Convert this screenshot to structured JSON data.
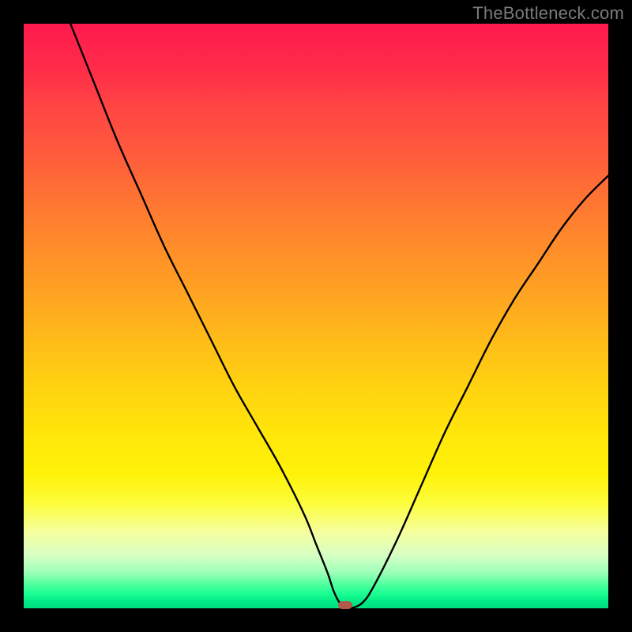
{
  "watermark": "TheBottleneck.com",
  "chart_data": {
    "type": "line",
    "title": "",
    "xlabel": "",
    "ylabel": "",
    "xlim": [
      0,
      100
    ],
    "ylim": [
      0,
      100
    ],
    "grid": false,
    "legend": false,
    "background_gradient": {
      "top": "#ff1a4d",
      "bottom": "#00e884"
    },
    "series": [
      {
        "name": "bottleneck-curve",
        "color": "#000000",
        "x": [
          8,
          12,
          16,
          20,
          24,
          28,
          32,
          36,
          40,
          44,
          48,
          50,
          52,
          53,
          54,
          55,
          56,
          58,
          60,
          64,
          68,
          72,
          76,
          80,
          84,
          88,
          92,
          96,
          100
        ],
        "y": [
          100,
          90,
          80,
          71,
          62,
          54,
          46,
          38,
          31,
          24,
          16,
          11,
          6,
          3,
          1,
          0,
          0,
          1,
          4,
          12,
          21,
          30,
          38,
          46,
          53,
          59,
          65,
          70,
          74
        ]
      }
    ],
    "marker": {
      "name": "optimal-point",
      "x": 55,
      "y": 0,
      "color": "#b15a4a"
    }
  }
}
